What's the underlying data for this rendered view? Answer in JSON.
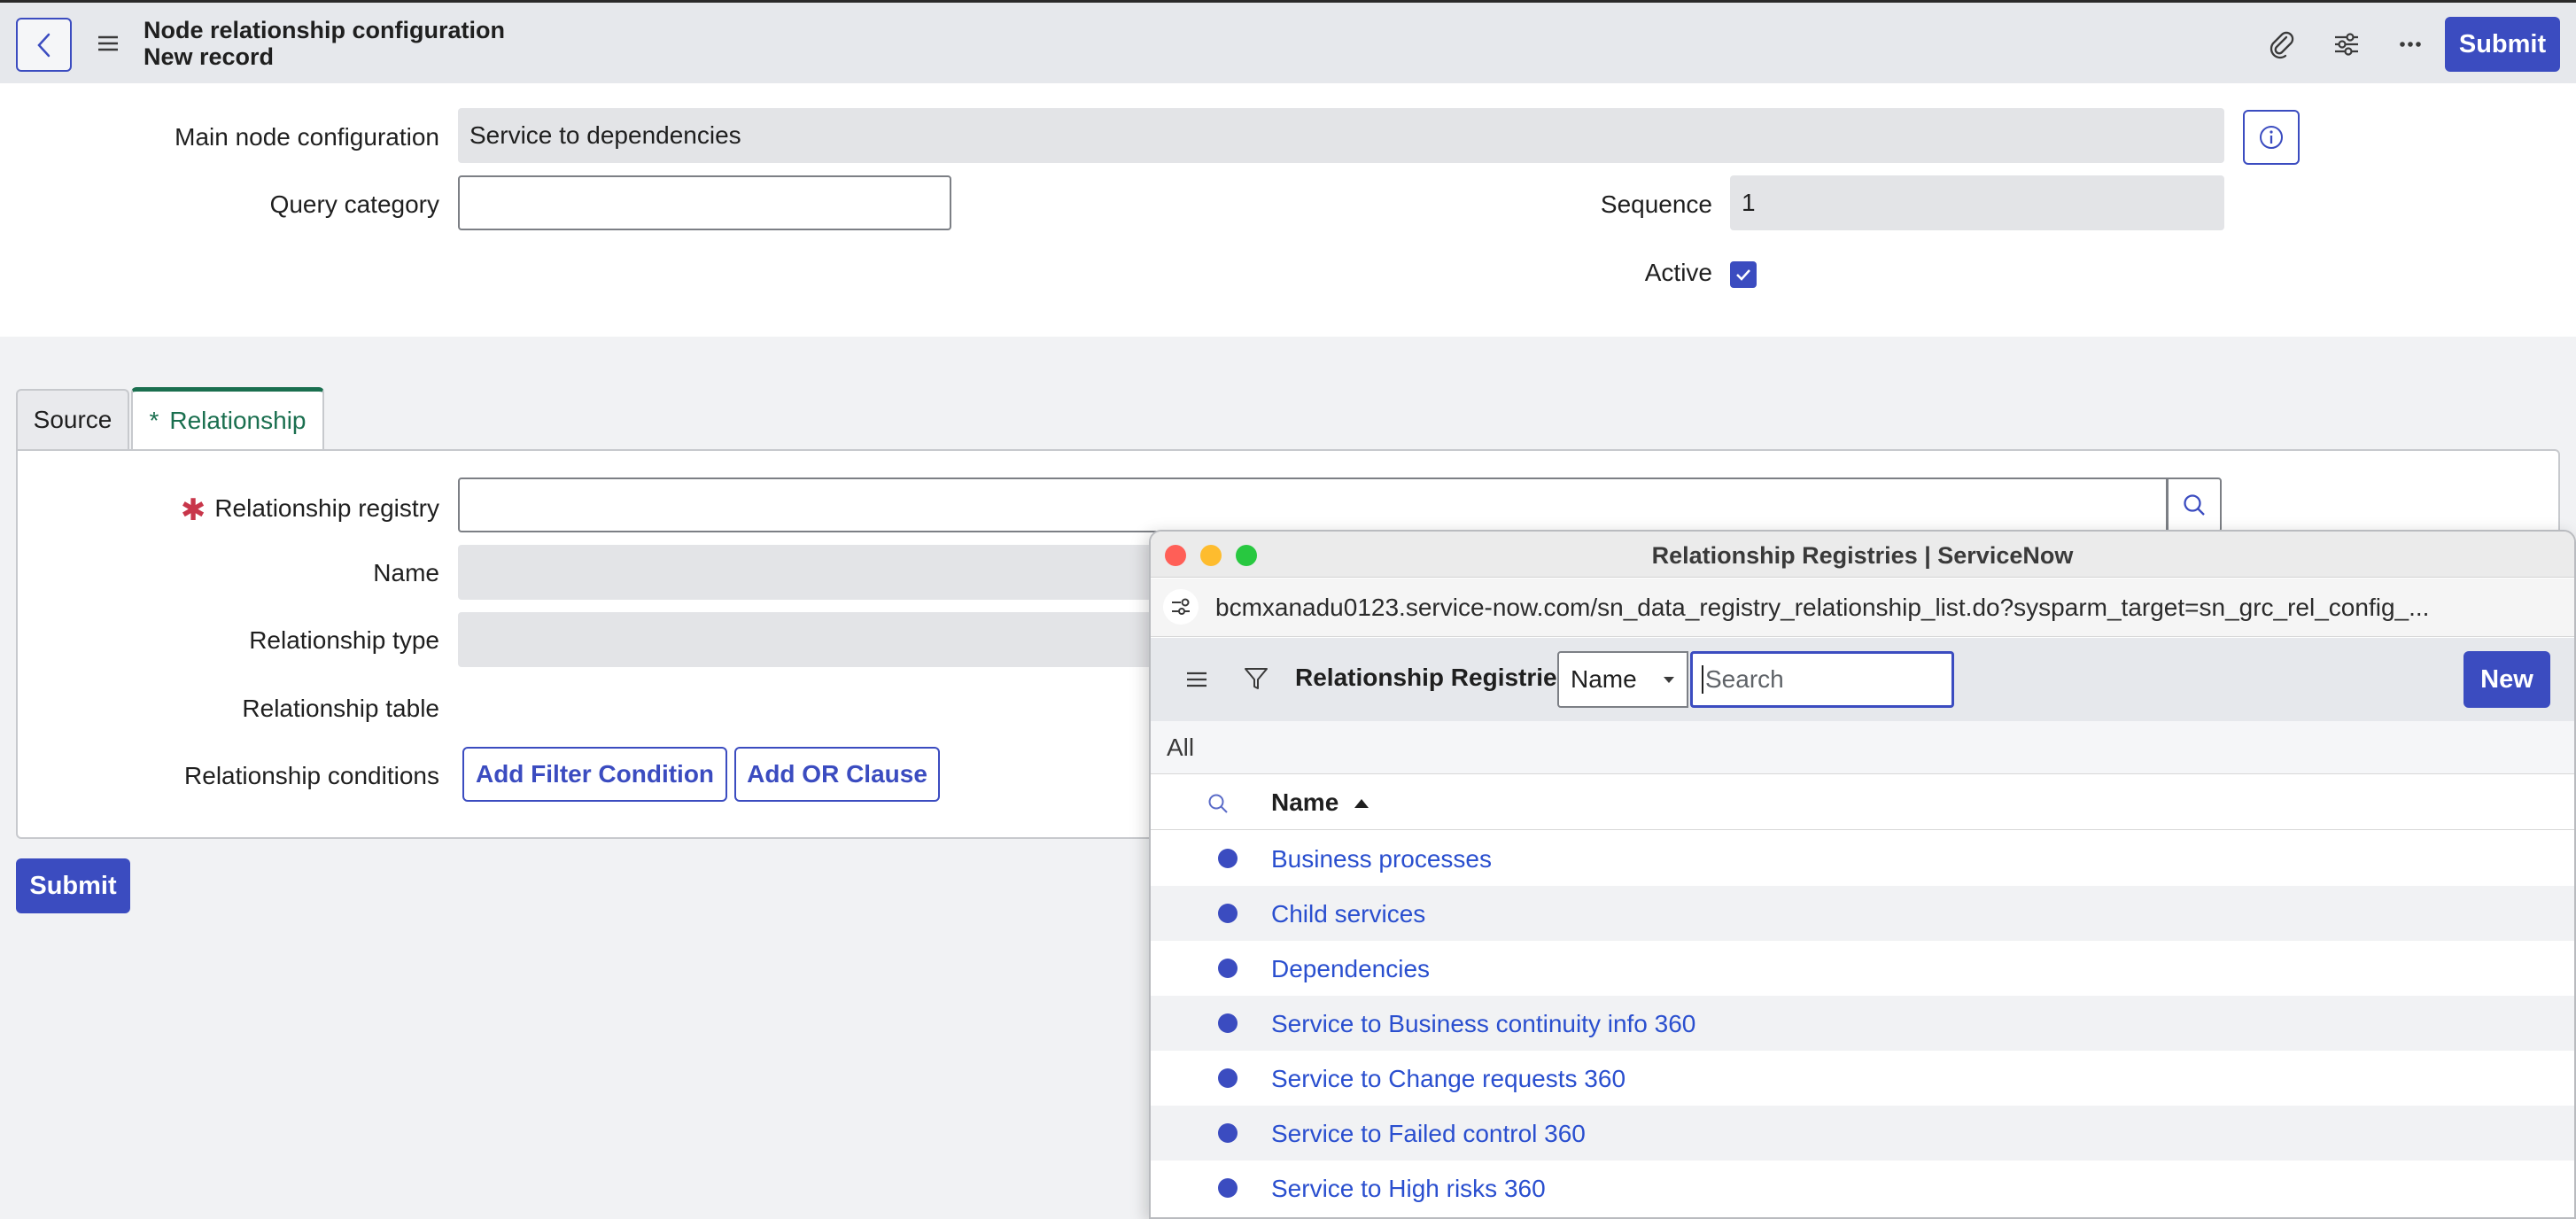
{
  "header": {
    "title_line1": "Node relationship configuration",
    "title_line2": "New record",
    "submit_label": "Submit"
  },
  "form": {
    "main_node_label": "Main node configuration",
    "main_node_value": "Service to dependencies",
    "query_category_label": "Query category",
    "query_category_value": "",
    "sequence_label": "Sequence",
    "sequence_value": "1",
    "active_label": "Active",
    "active_checked": true
  },
  "tabs": {
    "source": "Source",
    "relationship_star": "*",
    "relationship": "Relationship"
  },
  "relationship_form": {
    "registry_label": "Relationship registry",
    "name_label": "Name",
    "type_label": "Relationship type",
    "table_label": "Relationship table",
    "conditions_label": "Relationship conditions",
    "add_filter_label": "Add Filter Condition",
    "add_or_label": "Add OR Clause",
    "submit_label": "Submit"
  },
  "popup": {
    "window_title": "Relationship Registries | ServiceNow",
    "url": "bcmxanadu0123.service-now.com/sn_data_registry_relationship_list.do?sysparm_target=sn_grc_rel_config_...",
    "list_title": "Relationship Registries",
    "search_field": "Name",
    "search_placeholder": "Search",
    "new_label": "New",
    "breadcrumb": "All",
    "column_name": "Name",
    "rows": [
      "Business processes",
      "Child services",
      "Dependencies",
      "Service to Business continuity info 360",
      "Service to Change requests 360",
      "Service to Failed control 360",
      "Service to High risks 360"
    ]
  },
  "colors": {
    "accent": "#3b4cc0",
    "tab_active": "#1a6f4f",
    "required": "#c8364a",
    "link": "#2a4fcf"
  }
}
